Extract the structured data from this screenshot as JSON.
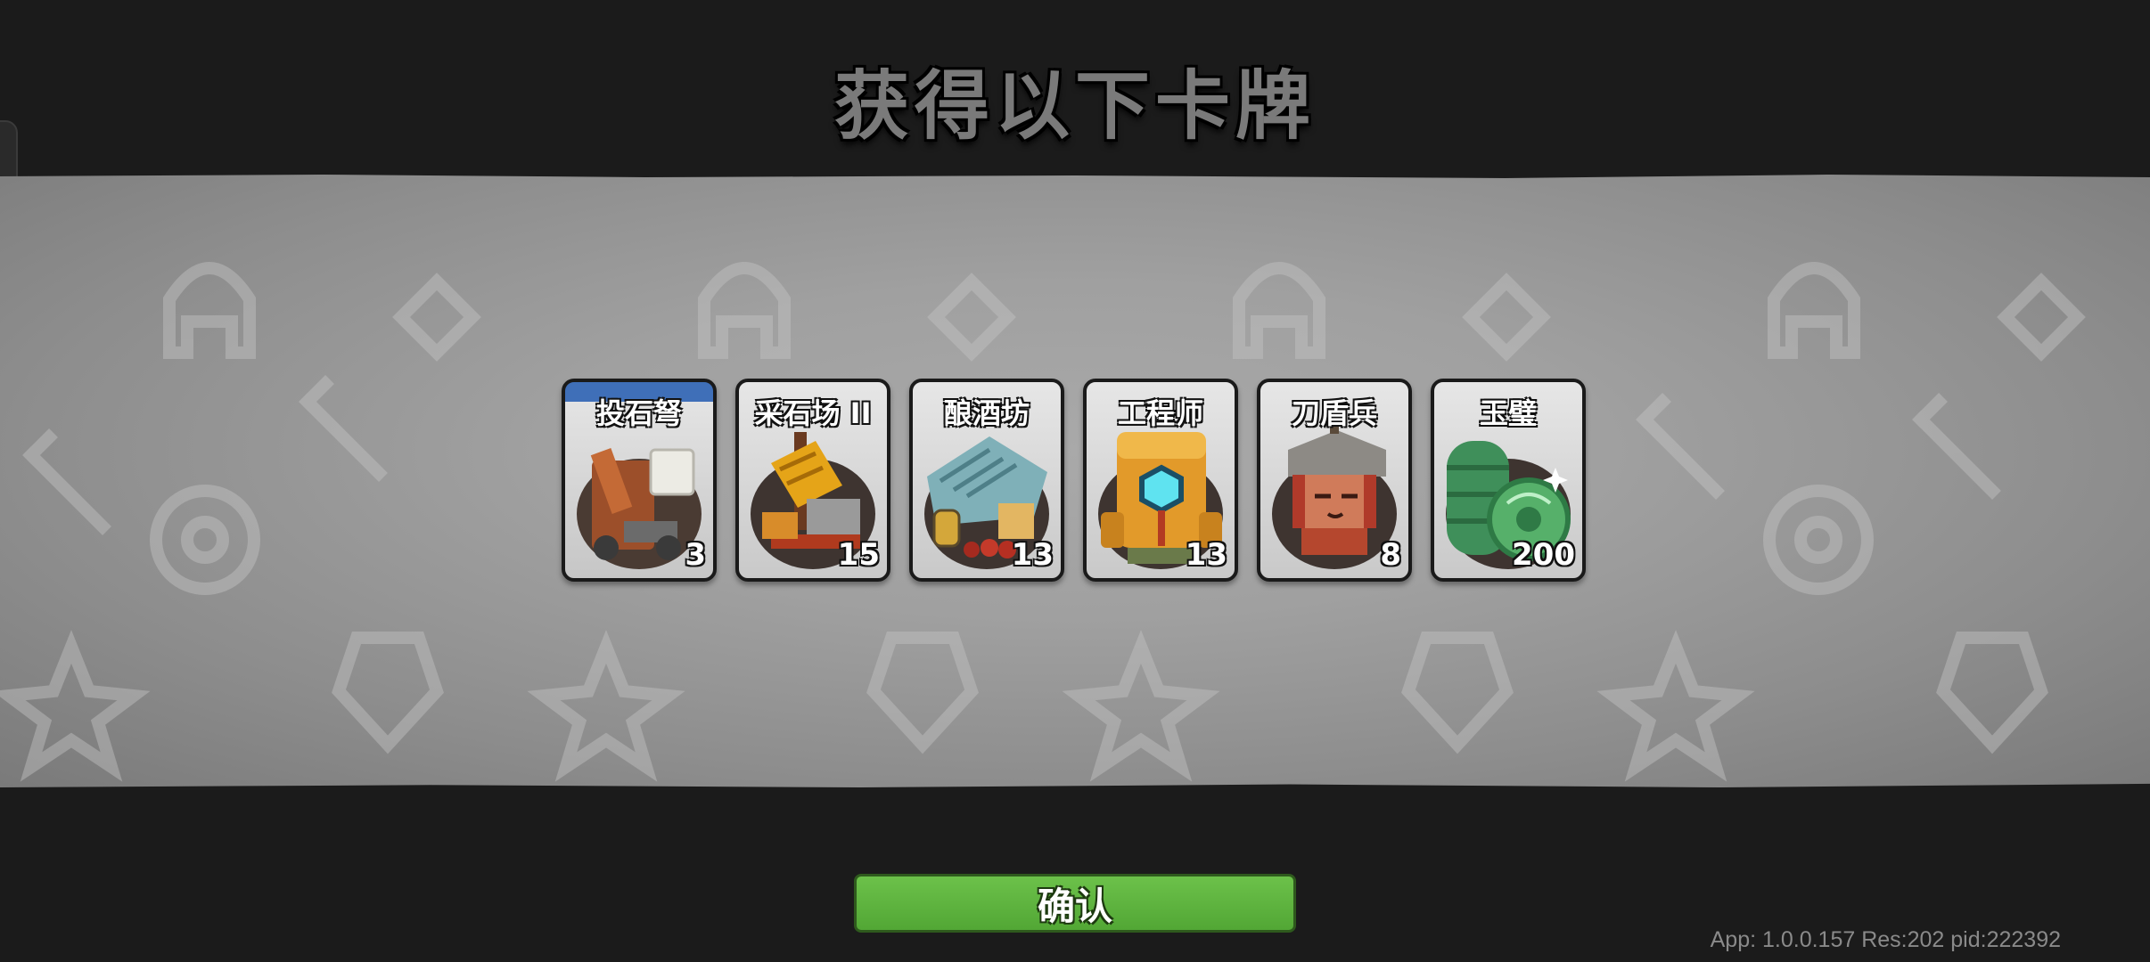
{
  "title": "获得以下卡牌",
  "cards": [
    {
      "name": "投石弩",
      "count": "3",
      "icon": "catapult-icon"
    },
    {
      "name": "采石场 II",
      "count": "15",
      "icon": "quarry-icon"
    },
    {
      "name": "酿酒坊",
      "count": "13",
      "icon": "brewery-icon"
    },
    {
      "name": "工程师",
      "count": "13",
      "icon": "engineer-icon"
    },
    {
      "name": "刀盾兵",
      "count": "8",
      "icon": "sword-shield-soldier-icon"
    },
    {
      "name": "玉璧",
      "count": "200",
      "icon": "jade-disc-icon"
    }
  ],
  "confirm_label": "确认",
  "version_text": "App: 1.0.0.157 Res:202 pid:222392",
  "colors": {
    "confirm": "#5cb33e",
    "background": "#1b1b1b",
    "band": "#9a9a9a"
  }
}
